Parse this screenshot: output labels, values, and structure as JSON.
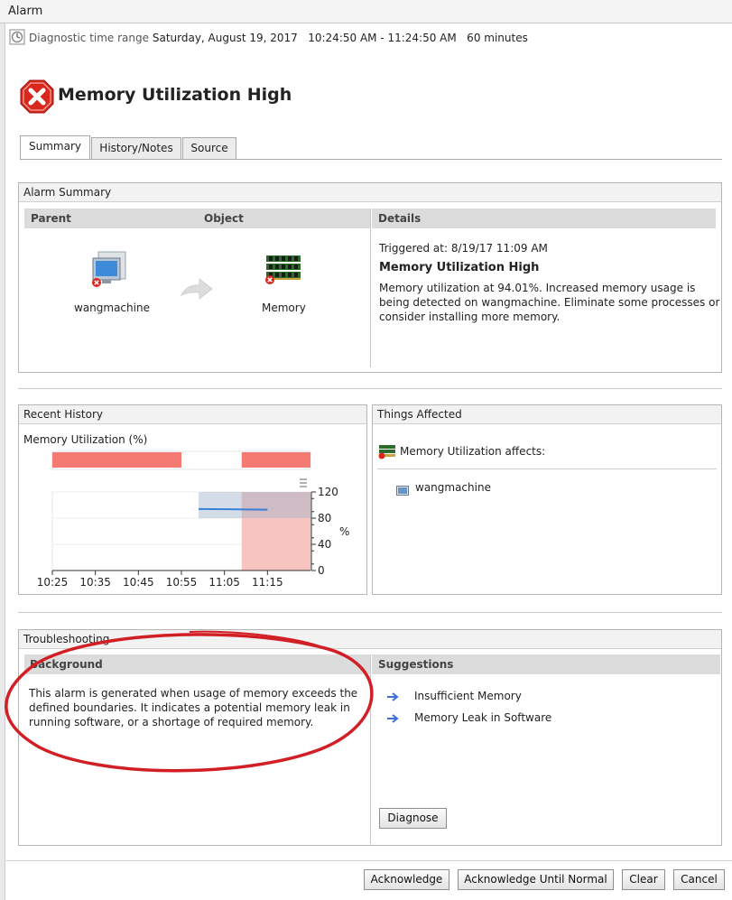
{
  "window": {
    "title": "Alarm"
  },
  "time_range": {
    "label": "Diagnostic time range",
    "value": "Saturday, August 19, 2017   10:24:50 AM - 11:24:50 AM   60 minutes"
  },
  "alarm": {
    "title": "Memory Utilization High"
  },
  "tabs": [
    {
      "label": "Summary"
    },
    {
      "label": "History/Notes"
    },
    {
      "label": "Source"
    }
  ],
  "alarm_summary": {
    "heading": "Alarm Summary",
    "col_parent": "Parent",
    "col_object": "Object",
    "col_details": "Details",
    "parent_name": "wangmachine",
    "object_name": "Memory",
    "triggered": "Triggered at: 8/19/17 11:09 AM",
    "details_title": "Memory Utilization High",
    "details_text_1": "Memory utilization at 94.01%. Increased memory usage is",
    "details_text_2": "being detected on wangmachine. Eliminate some processes or",
    "details_text_3": "consider installing more memory."
  },
  "recent_history": {
    "heading": "Recent History",
    "chart_title": "Memory Utilization (%)"
  },
  "chart_data": {
    "type": "line",
    "title": "Memory Utilization (%)",
    "ylabel": "%",
    "x_ticks": [
      "10:25",
      "10:35",
      "10:45",
      "10:55",
      "11:05",
      "11:15"
    ],
    "y_ticks": [
      0,
      40,
      80,
      120
    ],
    "ylim": [
      0,
      120
    ],
    "xlim_minutes": [
      0,
      60
    ],
    "series": [
      {
        "x_minutes": [
          34,
          50
        ],
        "values": [
          94,
          93
        ]
      }
    ],
    "alarm_bands_minutes": [
      [
        0,
        30
      ],
      [
        44,
        60
      ]
    ]
  },
  "things_affected": {
    "heading": "Things Affected",
    "affects_label": "Memory Utilization affects:",
    "items": [
      {
        "label": "wangmachine"
      }
    ]
  },
  "troubleshooting": {
    "heading": "Troubleshooting",
    "col_background": "Background",
    "col_suggestions": "Suggestions",
    "background_1": "This alarm is generated when usage of memory exceeds the",
    "background_2": "defined boundaries. It indicates a potential memory leak in",
    "background_3": "running software, or a shortage of required memory.",
    "suggestions": [
      {
        "label": "Insufficient Memory"
      },
      {
        "label": "Memory Leak in Software"
      }
    ],
    "diagnose_label": "Diagnose"
  },
  "footer": {
    "acknowledge": "Acknowledge",
    "acknowledge_until_normal": "Acknowledge Until Normal",
    "clear": "Clear",
    "cancel": "Cancel"
  },
  "colors": {
    "alarm_red": "#f47a72",
    "alarm_fill": "#f7c4c0",
    "line_blue": "#3a7fd8",
    "annotation_red": "#d21f26"
  }
}
